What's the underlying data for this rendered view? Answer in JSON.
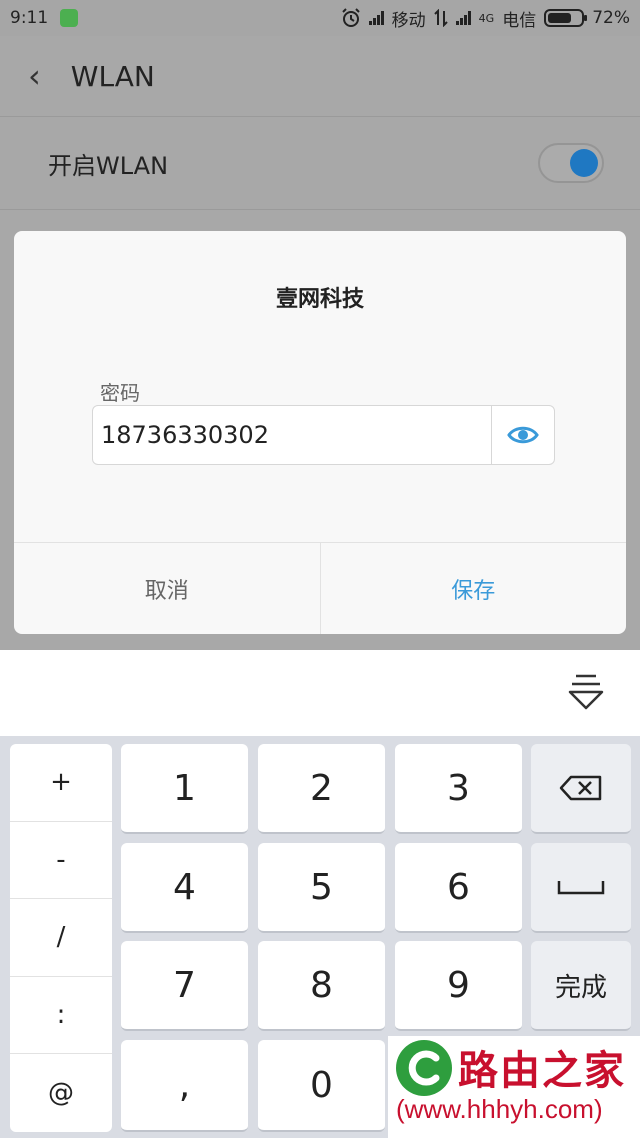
{
  "status_bar": {
    "time": "9:11",
    "carrier1": "移动",
    "net_type": "4G",
    "carrier2": "电信",
    "battery": "72%",
    "battery_level": 0.72
  },
  "header": {
    "title": "WLAN"
  },
  "wlan_toggle": {
    "label": "开启WLAN",
    "on": true
  },
  "dialog": {
    "title": "壹网科技",
    "password_label": "密码",
    "password_value": "18736330302",
    "cancel_label": "取消",
    "save_label": "保存"
  },
  "keyboard": {
    "symbols": [
      "+",
      "-",
      "/",
      ":",
      "@"
    ],
    "digits": [
      "1",
      "2",
      "3",
      "4",
      "5",
      "6",
      "7",
      "8",
      "9",
      ",",
      "0"
    ],
    "done_label": "完成"
  },
  "watermark": {
    "brand": "路由之家",
    "url": "(www.hhhyh.com)"
  },
  "colors": {
    "accent": "#3a9ad9",
    "toggle_knob": "#1f78c2",
    "watermark": "#c8102e"
  }
}
